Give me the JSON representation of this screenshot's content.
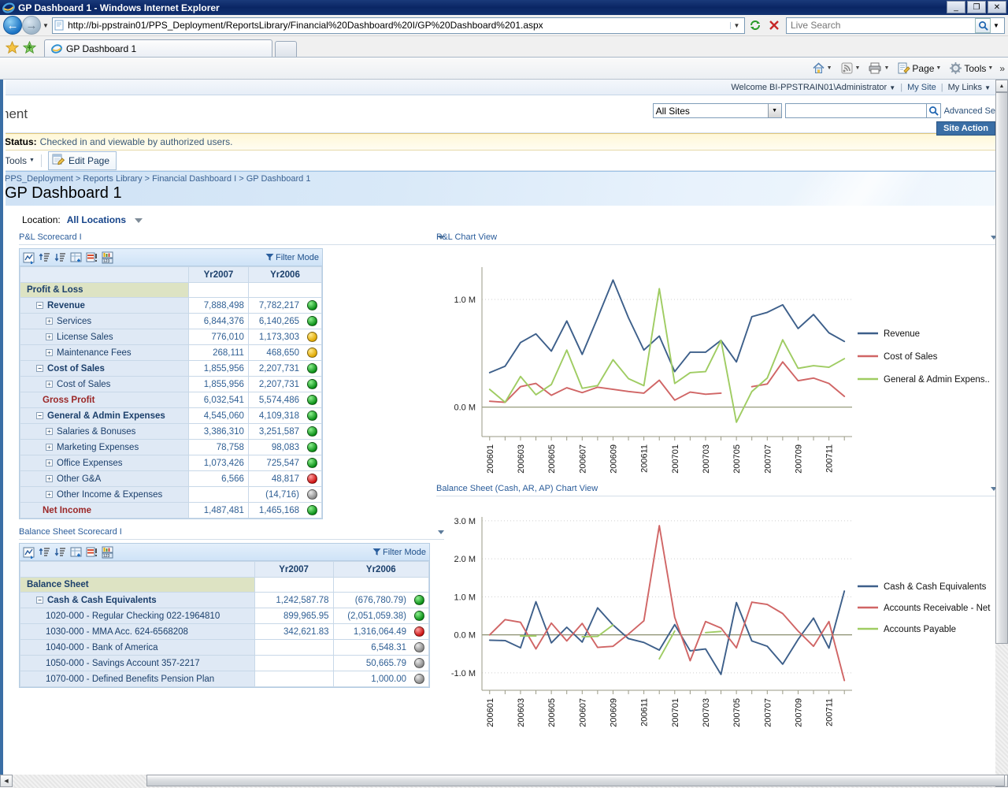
{
  "browser": {
    "window_title": "GP Dashboard 1 - Windows Internet Explorer",
    "url": "http://bi-ppstrain01/PPS_Deployment/ReportsLibrary/Financial%20Dashboard%20I/GP%20Dashboard%201.aspx",
    "search_placeholder": "Live Search",
    "tab_label": "GP Dashboard 1",
    "minimize_glyph": "_",
    "restore_glyph": "❐",
    "close_glyph": "✕",
    "back_glyph": "←",
    "forward_glyph": "→",
    "refresh_glyph": "↻",
    "stop_glyph": "✕",
    "command_items": [
      {
        "label": "",
        "icon": "home-icon"
      },
      {
        "label": "",
        "icon": "feeds-icon"
      },
      {
        "label": "",
        "icon": "print-icon"
      },
      {
        "label": "Page",
        "icon": "page-icon"
      },
      {
        "label": "Tools",
        "icon": "tools-icon"
      }
    ],
    "overflow_glyph": "»"
  },
  "sharepoint": {
    "welcome": "Welcome BI-PPSTRAIN01\\Administrator",
    "my_site": "My Site",
    "my_links": "My Links",
    "site_title_fragment": "nent",
    "search_scope": "All Sites",
    "search_value": "",
    "advanced_search": "Advanced Se",
    "site_actions": "Site Action",
    "status_label": "Status:",
    "status_text": "Checked in and viewable by authorized users.",
    "tools_menu": "Tools",
    "edit_page": "Edit Page",
    "breadcrumb": [
      "PPS_Deployment",
      "Reports Library",
      "Financial Dashboard I",
      "GP Dashboard 1"
    ],
    "breadcrumb_separator": ">",
    "page_title": "GP Dashboard 1"
  },
  "filter": {
    "location_label": "Location:",
    "location_value": "All Locations"
  },
  "webparts": {
    "pl_scorecard_title": "P&L Scorecard I",
    "pl_chart_title": "P&L Chart View",
    "bs_scorecard_title": "Balance Sheet Scorecard I",
    "bs_chart_title": "Balance Sheet (Cash, AR, AP) Chart View",
    "filter_mode": "Filter Mode",
    "toolbar_icons": [
      "refresh-scorecard-icon",
      "expand-all-icon",
      "collapse-all-icon",
      "add-column-icon",
      "annotation-icon",
      "values-icon"
    ]
  },
  "pl_scorecard": {
    "columns": [
      "",
      "Yr2007",
      "Yr2006"
    ],
    "rows": [
      {
        "label": "Profit & Loss",
        "indent": 0,
        "node": "",
        "style": "header",
        "yr2007": "",
        "yr2006": "",
        "kpi": ""
      },
      {
        "label": "Revenue",
        "indent": 1,
        "node": "minus",
        "style": "bold",
        "yr2007": "7,888,498",
        "yr2006": "7,782,217",
        "kpi": "green"
      },
      {
        "label": "Services",
        "indent": 2,
        "node": "plus",
        "style": "normal",
        "yr2007": "6,844,376",
        "yr2006": "6,140,265",
        "kpi": "green"
      },
      {
        "label": "License Sales",
        "indent": 2,
        "node": "plus",
        "style": "normal",
        "yr2007": "776,010",
        "yr2006": "1,173,303",
        "kpi": "yellow"
      },
      {
        "label": "Maintenance Fees",
        "indent": 2,
        "node": "plus",
        "style": "normal",
        "yr2007": "268,111",
        "yr2006": "468,650",
        "kpi": "yellow"
      },
      {
        "label": "Cost of Sales",
        "indent": 1,
        "node": "minus",
        "style": "bold",
        "yr2007": "1,855,956",
        "yr2006": "2,207,731",
        "kpi": "green"
      },
      {
        "label": "Cost of Sales",
        "indent": 2,
        "node": "plus",
        "style": "normal",
        "yr2007": "1,855,956",
        "yr2006": "2,207,731",
        "kpi": "green"
      },
      {
        "label": "Gross Profit",
        "indent": 2,
        "node": "",
        "style": "red",
        "yr2007": "6,032,541",
        "yr2006": "5,574,486",
        "kpi": "green"
      },
      {
        "label": "General & Admin Expenses",
        "indent": 1,
        "node": "minus",
        "style": "bold",
        "yr2007": "4,545,060",
        "yr2006": "4,109,318",
        "kpi": "green"
      },
      {
        "label": "Salaries & Bonuses",
        "indent": 2,
        "node": "plus",
        "style": "normal",
        "yr2007": "3,386,310",
        "yr2006": "3,251,587",
        "kpi": "green"
      },
      {
        "label": "Marketing Expenses",
        "indent": 2,
        "node": "plus",
        "style": "normal",
        "yr2007": "78,758",
        "yr2006": "98,083",
        "kpi": "green"
      },
      {
        "label": "Office Expenses",
        "indent": 2,
        "node": "plus",
        "style": "normal",
        "yr2007": "1,073,426",
        "yr2006": "725,547",
        "kpi": "green"
      },
      {
        "label": "Other G&A",
        "indent": 2,
        "node": "plus",
        "style": "normal",
        "yr2007": "6,566",
        "yr2006": "48,817",
        "kpi": "red"
      },
      {
        "label": "Other Income & Expenses",
        "indent": 2,
        "node": "plus",
        "style": "normal",
        "yr2007": "",
        "yr2006": "(14,716)",
        "kpi": "gray"
      },
      {
        "label": "Net Income",
        "indent": 2,
        "node": "",
        "style": "red",
        "yr2007": "1,487,481",
        "yr2006": "1,465,168",
        "kpi": "green"
      }
    ]
  },
  "bs_scorecard": {
    "columns": [
      "",
      "Yr2007",
      "Yr2006"
    ],
    "rows": [
      {
        "label": "Balance Sheet",
        "indent": 0,
        "node": "",
        "style": "header",
        "yr2007": "",
        "yr2006": "",
        "kpi": ""
      },
      {
        "label": "Cash & Cash Equivalents",
        "indent": 1,
        "node": "minus",
        "style": "bold",
        "yr2007": "1,242,587.78",
        "yr2006": "(676,780.79)",
        "kpi": "green"
      },
      {
        "label": "1020-000 - Regular Checking 022-1964810",
        "indent": 2,
        "node": "",
        "style": "normal",
        "yr2007": "899,965.95",
        "yr2006": "(2,051,059.38)",
        "kpi": "green"
      },
      {
        "label": "1030-000 - MMA Acc. 624-6568208",
        "indent": 2,
        "node": "",
        "style": "normal",
        "yr2007": "342,621.83",
        "yr2006": "1,316,064.49",
        "kpi": "red"
      },
      {
        "label": "1040-000 - Bank of America",
        "indent": 2,
        "node": "",
        "style": "normal",
        "yr2007": "",
        "yr2006": "6,548.31",
        "kpi": "gray"
      },
      {
        "label": "1050-000 - Savings Account 357-2217",
        "indent": 2,
        "node": "",
        "style": "normal",
        "yr2007": "",
        "yr2006": "50,665.79",
        "kpi": "gray"
      },
      {
        "label": "1070-000 - Defined Benefits Pension Plan",
        "indent": 2,
        "node": "",
        "style": "normal",
        "yr2007": "",
        "yr2006": "1,000.00",
        "kpi": "gray"
      }
    ]
  },
  "colors": {
    "revenue": "#3d5f8a",
    "cost_of_sales": "#d06565",
    "admin_expenses": "#9fcc62",
    "cash": "#3d5f8a",
    "ar_net": "#d06565",
    "ap": "#9fcc62",
    "accent_blue": "#3a6ea5",
    "kpi_green": "#0a8f17",
    "kpi_yellow": "#e0a800",
    "kpi_red": "#cc1111",
    "kpi_gray": "#8a8a8a"
  },
  "chart_data": [
    {
      "type": "line",
      "title": "P&L Chart View",
      "xlabel": "",
      "ylabel": "",
      "ylim": [
        -0.2,
        1.3
      ],
      "ytick_labels": [
        "0.0 M",
        "1.0 M"
      ],
      "ytick_values": [
        0,
        1000000
      ],
      "grid": true,
      "legend_position": "right",
      "x": [
        "200601",
        "200602",
        "200603",
        "200604",
        "200605",
        "200606",
        "200607",
        "200608",
        "200609",
        "200610",
        "200611",
        "200612",
        "200701",
        "200702",
        "200703",
        "200704",
        "200705",
        "200706",
        "200707",
        "200708",
        "200709",
        "200710",
        "200711",
        "200712"
      ],
      "xtick_labels": [
        "200601",
        "200603",
        "200605",
        "200607",
        "200609",
        "200611",
        "200701",
        "200703",
        "200705",
        "200707",
        "200709",
        "200711"
      ],
      "series": [
        {
          "name": "Revenue",
          "color": "#3d5f8a",
          "values": [
            0.32,
            0.38,
            0.6,
            0.68,
            0.52,
            0.8,
            0.49,
            0.83,
            1.18,
            0.83,
            0.53,
            0.66,
            0.33,
            0.51,
            0.51,
            0.62,
            0.42,
            0.84,
            0.88,
            0.95,
            0.73,
            0.86,
            0.69,
            0.61
          ]
        },
        {
          "name": "Cost of Sales",
          "color": "#d06565",
          "values": [
            0.055,
            0.045,
            0.19,
            0.22,
            0.11,
            0.18,
            0.135,
            0.185,
            0.165,
            0.145,
            0.13,
            0.25,
            0.065,
            0.14,
            0.12,
            0.13,
            null,
            0.19,
            0.215,
            0.42,
            0.245,
            0.27,
            0.22,
            0.1
          ]
        },
        {
          "name": "General & Admin Expens..",
          "color": "#9fcc62",
          "values": [
            0.165,
            0.045,
            0.285,
            0.115,
            0.21,
            0.53,
            0.175,
            0.2,
            0.44,
            0.265,
            0.2,
            1.1,
            0.22,
            0.32,
            0.33,
            0.62,
            -0.14,
            0.145,
            0.27,
            0.625,
            0.36,
            0.385,
            0.37,
            0.45
          ]
        }
      ]
    },
    {
      "type": "line",
      "title": "Balance Sheet (Cash, AR, AP) Chart View",
      "xlabel": "",
      "ylabel": "",
      "ylim": [
        -1.25,
        3.1
      ],
      "ytick_labels": [
        "-1.0 M",
        "0.0 M",
        "1.0 M",
        "2.0 M",
        "3.0 M"
      ],
      "ytick_values": [
        -1000000,
        0,
        1000000,
        2000000,
        3000000
      ],
      "grid": true,
      "legend_position": "right",
      "x": [
        "200601",
        "200602",
        "200603",
        "200604",
        "200605",
        "200606",
        "200607",
        "200608",
        "200609",
        "200610",
        "200611",
        "200612",
        "200701",
        "200702",
        "200703",
        "200704",
        "200705",
        "200706",
        "200707",
        "200708",
        "200709",
        "200710",
        "200711",
        "200712"
      ],
      "xtick_labels": [
        "200601",
        "200603",
        "200605",
        "200607",
        "200609",
        "200611",
        "200701",
        "200703",
        "200705",
        "200707",
        "200709",
        "200711"
      ],
      "series": [
        {
          "name": "Cash & Cash Equivalents",
          "color": "#3d5f8a",
          "values": [
            -0.14,
            -0.15,
            -0.34,
            0.87,
            -0.21,
            0.2,
            -0.19,
            0.71,
            0.26,
            -0.1,
            -0.2,
            -0.4,
            0.27,
            -0.42,
            -0.37,
            -1.04,
            0.85,
            -0.16,
            -0.3,
            -0.77,
            -0.12,
            0.44,
            -0.35,
            1.15
          ]
        },
        {
          "name": "Accounts Receivable - Net",
          "color": "#d06565",
          "values": [
            0.0,
            0.4,
            0.33,
            -0.37,
            0.31,
            -0.16,
            0.3,
            -0.33,
            -0.3,
            0.02,
            0.37,
            2.87,
            0.46,
            -0.68,
            0.35,
            0.18,
            -0.34,
            0.86,
            0.8,
            0.56,
            0.1,
            -0.3,
            0.35,
            -1.2
          ]
        },
        {
          "name": "Accounts Payable",
          "color": "#9fcc62",
          "values": [
            null,
            null,
            -0.03,
            -0.03,
            null,
            null,
            -0.05,
            -0.04,
            0.26,
            null,
            null,
            -0.63,
            0.1,
            null,
            0.06,
            0.09,
            null,
            null,
            null,
            null,
            null,
            null,
            null,
            null
          ]
        }
      ]
    }
  ]
}
